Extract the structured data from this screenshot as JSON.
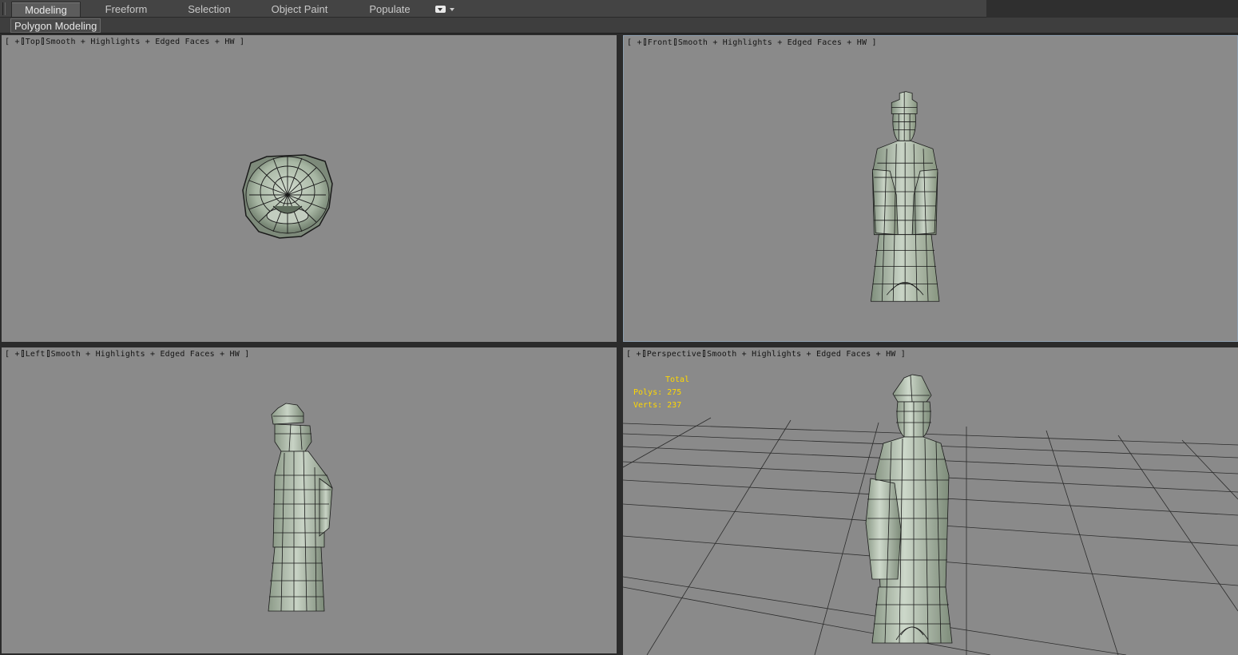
{
  "ribbon": {
    "tabs": [
      {
        "label": "Modeling",
        "active": true
      },
      {
        "label": "Freeform",
        "active": false
      },
      {
        "label": "Selection",
        "active": false
      },
      {
        "label": "Object Paint",
        "active": false
      },
      {
        "label": "Populate",
        "active": false
      }
    ],
    "options_icon": "dropdown-box-icon",
    "panel_label": "Polygon Modeling"
  },
  "viewports": {
    "top": {
      "bracket_open": "[",
      "plus": "+",
      "view": "Top",
      "shading": "Smooth + Highlights + Edged Faces + HW",
      "bracket_close": "]"
    },
    "front": {
      "bracket_open": "[",
      "plus": "+",
      "view": "Front",
      "shading": "Smooth + Highlights + Edged Faces + HW",
      "bracket_close": "]"
    },
    "left": {
      "bracket_open": "[",
      "plus": "+",
      "view": "Left",
      "shading": "Smooth + Highlights + Edged Faces + HW",
      "bracket_close": "]"
    },
    "perspective": {
      "bracket_open": "[",
      "plus": "+",
      "view": "Perspective",
      "shading": "Smooth + Highlights + Edged Faces + HW",
      "bracket_close": "]"
    }
  },
  "stats": {
    "header": "Total",
    "polys_label": "Polys:",
    "polys_value": "275",
    "verts_label": "Verts:",
    "verts_value": "237"
  },
  "colors": {
    "viewport_bg": "#8a8a8a",
    "model_fill": "#a8b8a4",
    "wire": "#1a1a1a",
    "stats_text": "#ffd800",
    "active_border": "#8fa0b0"
  }
}
